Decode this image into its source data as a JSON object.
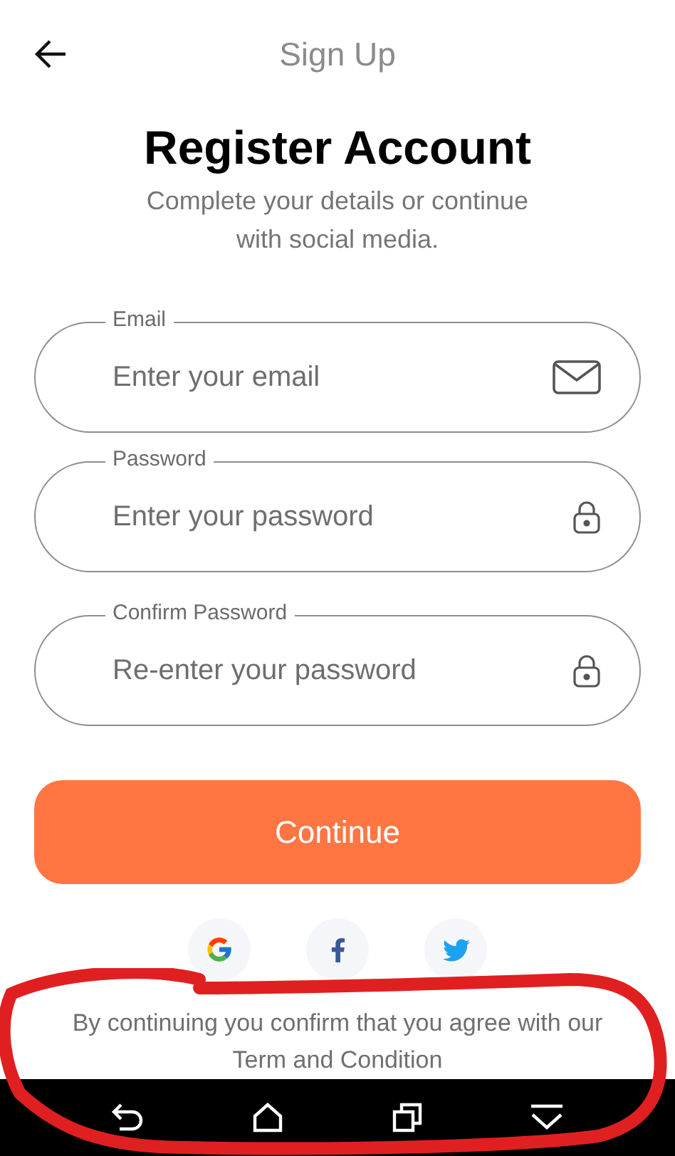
{
  "header": {
    "title": "Sign Up"
  },
  "heading": "Register Account",
  "subtitle": "Complete your details or continue with social media.",
  "fields": [
    {
      "kind": "email",
      "label": "Email",
      "placeholder": "Enter your email"
    },
    {
      "kind": "password",
      "label": "Password",
      "placeholder": "Enter your password"
    },
    {
      "kind": "password",
      "label": "Confirm Password",
      "placeholder": "Re-enter your password"
    }
  ],
  "button": "Continue",
  "social": [
    {
      "kind": "google"
    },
    {
      "kind": "facebook"
    },
    {
      "kind": "twitter"
    }
  ],
  "terms": "By continuing you confirm that you agree with our Term and Condition"
}
